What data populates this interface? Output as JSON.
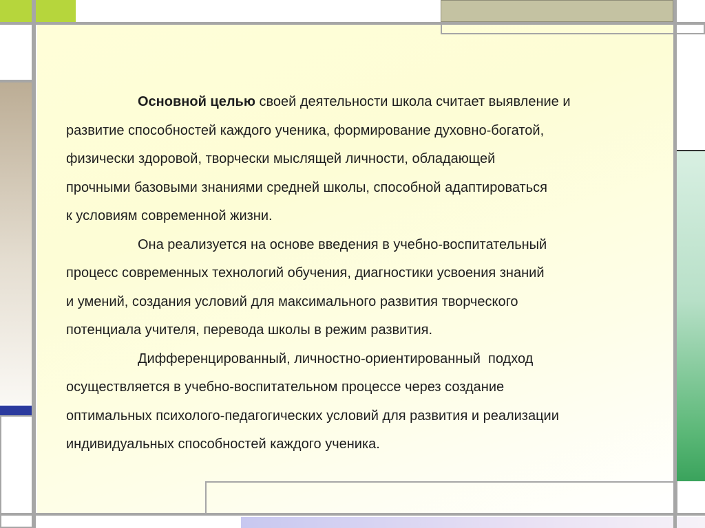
{
  "paragraphs": [
    {
      "lead": "Основной целью",
      "lines": [
        " своей деятельности школа считает выявление и",
        "развитие способностей каждого ученика, формирование духовно-богатой,",
        "физически здоровой, творчески мыслящей личности, обладающей",
        "прочными базовыми знаниями средней школы, способной адаптироваться",
        "к условиям современной жизни."
      ]
    },
    {
      "lines": [
        "Она реализуется на основе введения в учебно-воспитательный",
        "процесс современных технологий обучения, диагностики усвоения знаний",
        "и умений, создания условий для максимального развития творческого",
        "потенциала учителя, перевода школы в режим развития."
      ]
    },
    {
      "lines": [
        "Дифференцированный, личностно-ориентированный  подход",
        "осуществляется в учебно-воспитательном процессе через создание",
        "оптимальных психолого-педагогических условий для развития и реализации",
        "индивидуальных способностей каждого ученика."
      ]
    }
  ],
  "colors": {
    "accent_green": "#c8e05c",
    "accent_tan": "#c4c2a2",
    "accent_brown": "#bcad95",
    "accent_blue": "#2b3a9e",
    "accent_mint": "#c4e6d6",
    "accent_dark_green": "#3aa35c",
    "frame_gray": "#a6a6a6"
  }
}
